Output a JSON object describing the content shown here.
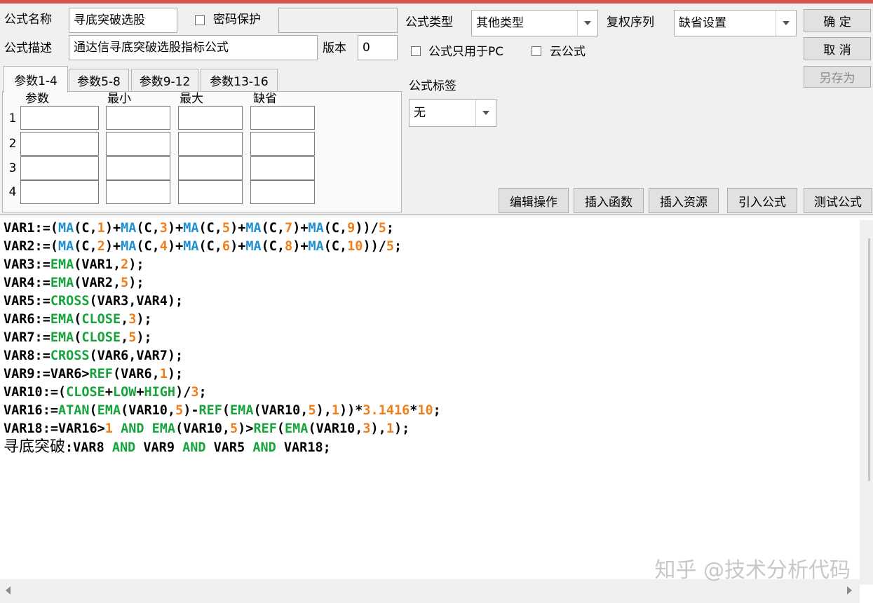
{
  "header": {
    "name_label": "公式名称",
    "name_value": "寻底突破选股",
    "password_label": "密码保护",
    "password_value": "",
    "desc_label": "公式描述",
    "desc_value": "通达信寻底突破选股指标公式",
    "version_label": "版本",
    "version_value": "0",
    "type_label": "公式类型",
    "type_value": "其他类型",
    "rights_label": "复权序列",
    "rights_value": "缺省设置",
    "pc_only_label": "公式只用于PC",
    "cloud_label": "云公式",
    "tag_label": "公式标签",
    "tag_value": "无"
  },
  "buttons": {
    "ok": "确  定",
    "cancel": "取  消",
    "save_as": "另存为",
    "edit_ops": "编辑操作",
    "insert_func": "插入函数",
    "insert_res": "插入资源",
    "import_formula": "引入公式",
    "test_formula": "测试公式"
  },
  "tabs": [
    "参数1-4",
    "参数5-8",
    "参数9-12",
    "参数13-16"
  ],
  "params": {
    "columns": [
      "参数",
      "最小",
      "最大",
      "缺省"
    ],
    "rows": [
      "1",
      "2",
      "3",
      "4"
    ]
  },
  "code": {
    "lines": [
      "VAR1:=(MA(C,1)+MA(C,3)+MA(C,5)+MA(C,7)+MA(C,9))/5;",
      "VAR2:=(MA(C,2)+MA(C,4)+MA(C,6)+MA(C,8)+MA(C,10))/5;",
      "VAR3:=EMA(VAR1,2);",
      "VAR4:=EMA(VAR2,5);",
      "VAR5:=CROSS(VAR3,VAR4);",
      "VAR6:=EMA(CLOSE,3);",
      "VAR7:=EMA(CLOSE,5);",
      "VAR8:=CROSS(VAR6,VAR7);",
      "VAR9:=VAR6>REF(VAR6,1);",
      "VAR10:=(CLOSE+LOW+HIGH)/3;",
      "VAR16:=ATAN(EMA(VAR10,5)-REF(EMA(VAR10,5),1))*3.1416*10;",
      "VAR18:=VAR16>1 AND EMA(VAR10,5)>REF(EMA(VAR10,3),1);",
      "寻底突破:VAR8 AND VAR9 AND VAR5 AND VAR18;"
    ]
  },
  "watermark": "知乎 @技术分析代码",
  "colors": {
    "function_blue": "#1e90d0",
    "function_green": "#17a43c",
    "number_orange": "#f07f1a",
    "title_bar": "#d9534f"
  }
}
